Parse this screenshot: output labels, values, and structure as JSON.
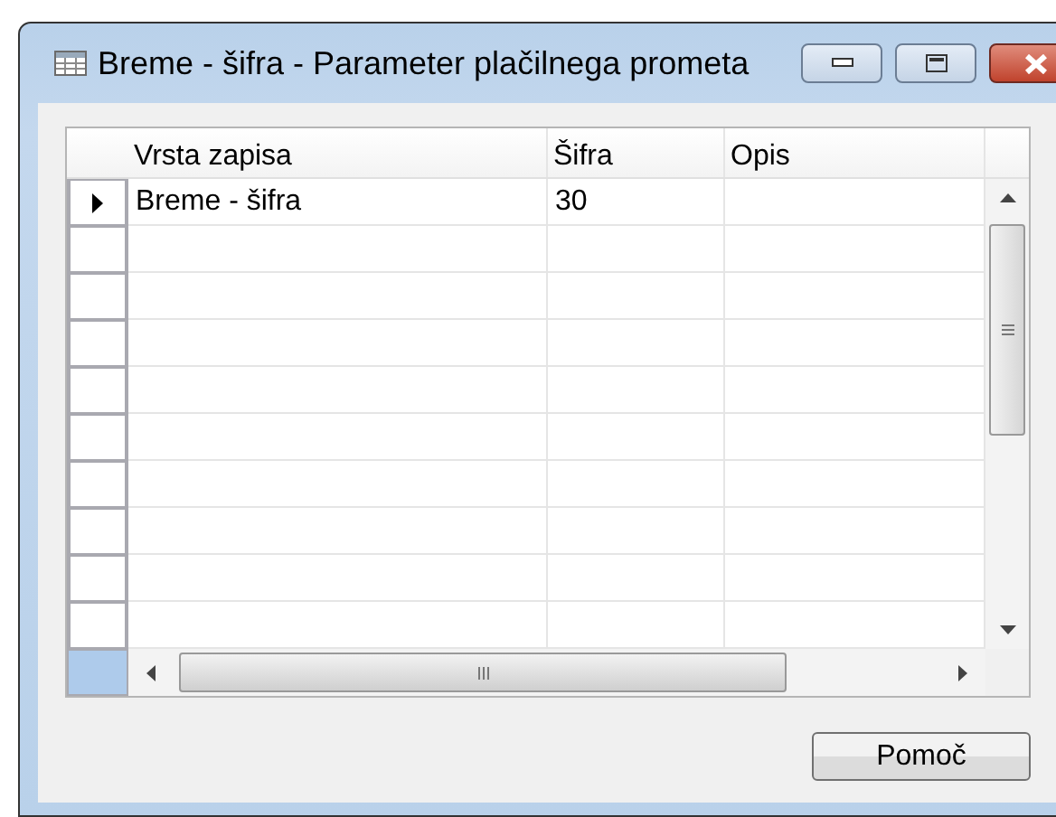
{
  "window": {
    "title": "Breme - šifra - Parameter plačilnega prometa"
  },
  "table": {
    "columns": [
      "Vrsta zapisa",
      "Šifra",
      "Opis"
    ],
    "rows": [
      {
        "cells": [
          "Breme - šifra",
          "30",
          ""
        ],
        "selected": true
      }
    ]
  },
  "buttons": [
    "Pomoč"
  ]
}
